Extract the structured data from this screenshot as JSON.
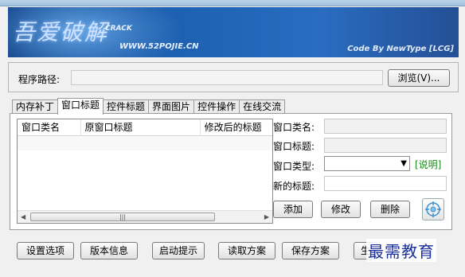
{
  "banner": {
    "logo_text": "吾爱破解",
    "crack": "CRACK",
    "url": "WWW.52POJIE.CN",
    "author": "Code By NewType [LCG]"
  },
  "path": {
    "label": "程序路径:",
    "value": "",
    "browse_label": "浏览(V)..."
  },
  "tabs": [
    {
      "label": "内存补丁"
    },
    {
      "label": "窗口标题"
    },
    {
      "label": "控件标题"
    },
    {
      "label": "界面图片"
    },
    {
      "label": "控件操作"
    },
    {
      "label": "在线交流"
    }
  ],
  "list": {
    "columns": [
      "窗口类名",
      "原窗口标题",
      "修改后的标题"
    ],
    "rows": [
      [
        "",
        "",
        ""
      ]
    ]
  },
  "fields": {
    "class_label": "窗口类名:",
    "title_label": "窗口标题:",
    "type_label": "窗口类型:",
    "new_title_label": "新的标题:",
    "help": "[说明]"
  },
  "actions": {
    "add": "添加",
    "modify": "修改",
    "delete": "删除"
  },
  "bottom": {
    "settings": "设置选项",
    "version": "版本信息",
    "startup": "启动提示",
    "read_scheme": "读取方案",
    "save_scheme": "保存方案",
    "generate": "生"
  },
  "watermark": "最需教育",
  "colors": {
    "banner": "#1d5fb0",
    "help_link": "#1a8a1a",
    "watermark": "#1b2f9a"
  }
}
